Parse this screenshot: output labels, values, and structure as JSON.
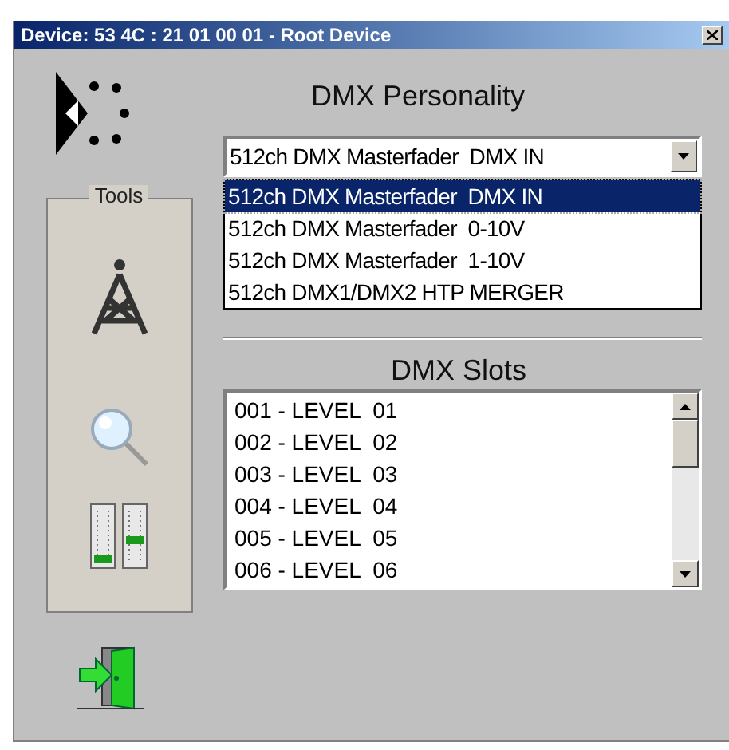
{
  "window": {
    "title": "Device:  53 4C : 21 01 00 01 - Root Device"
  },
  "tools": {
    "label": "Tools"
  },
  "personality": {
    "heading": "DMX Personality",
    "value": "512ch DMX Masterfader  DMX IN",
    "expanded": true,
    "options": [
      {
        "label": "512ch DMX Masterfader  DMX IN",
        "selected": true
      },
      {
        "label": "512ch DMX Masterfader  0-10V",
        "selected": false
      },
      {
        "label": "512ch DMX Masterfader  1-10V",
        "selected": false
      },
      {
        "label": "512ch DMX1/DMX2 HTP MERGER",
        "selected": false
      }
    ]
  },
  "slots": {
    "heading": "DMX Slots",
    "items": [
      "001 - LEVEL  01",
      "002 - LEVEL  02",
      "003 - LEVEL  03",
      "004 - LEVEL  04",
      "005 - LEVEL  05",
      "006 - LEVEL  06"
    ]
  }
}
